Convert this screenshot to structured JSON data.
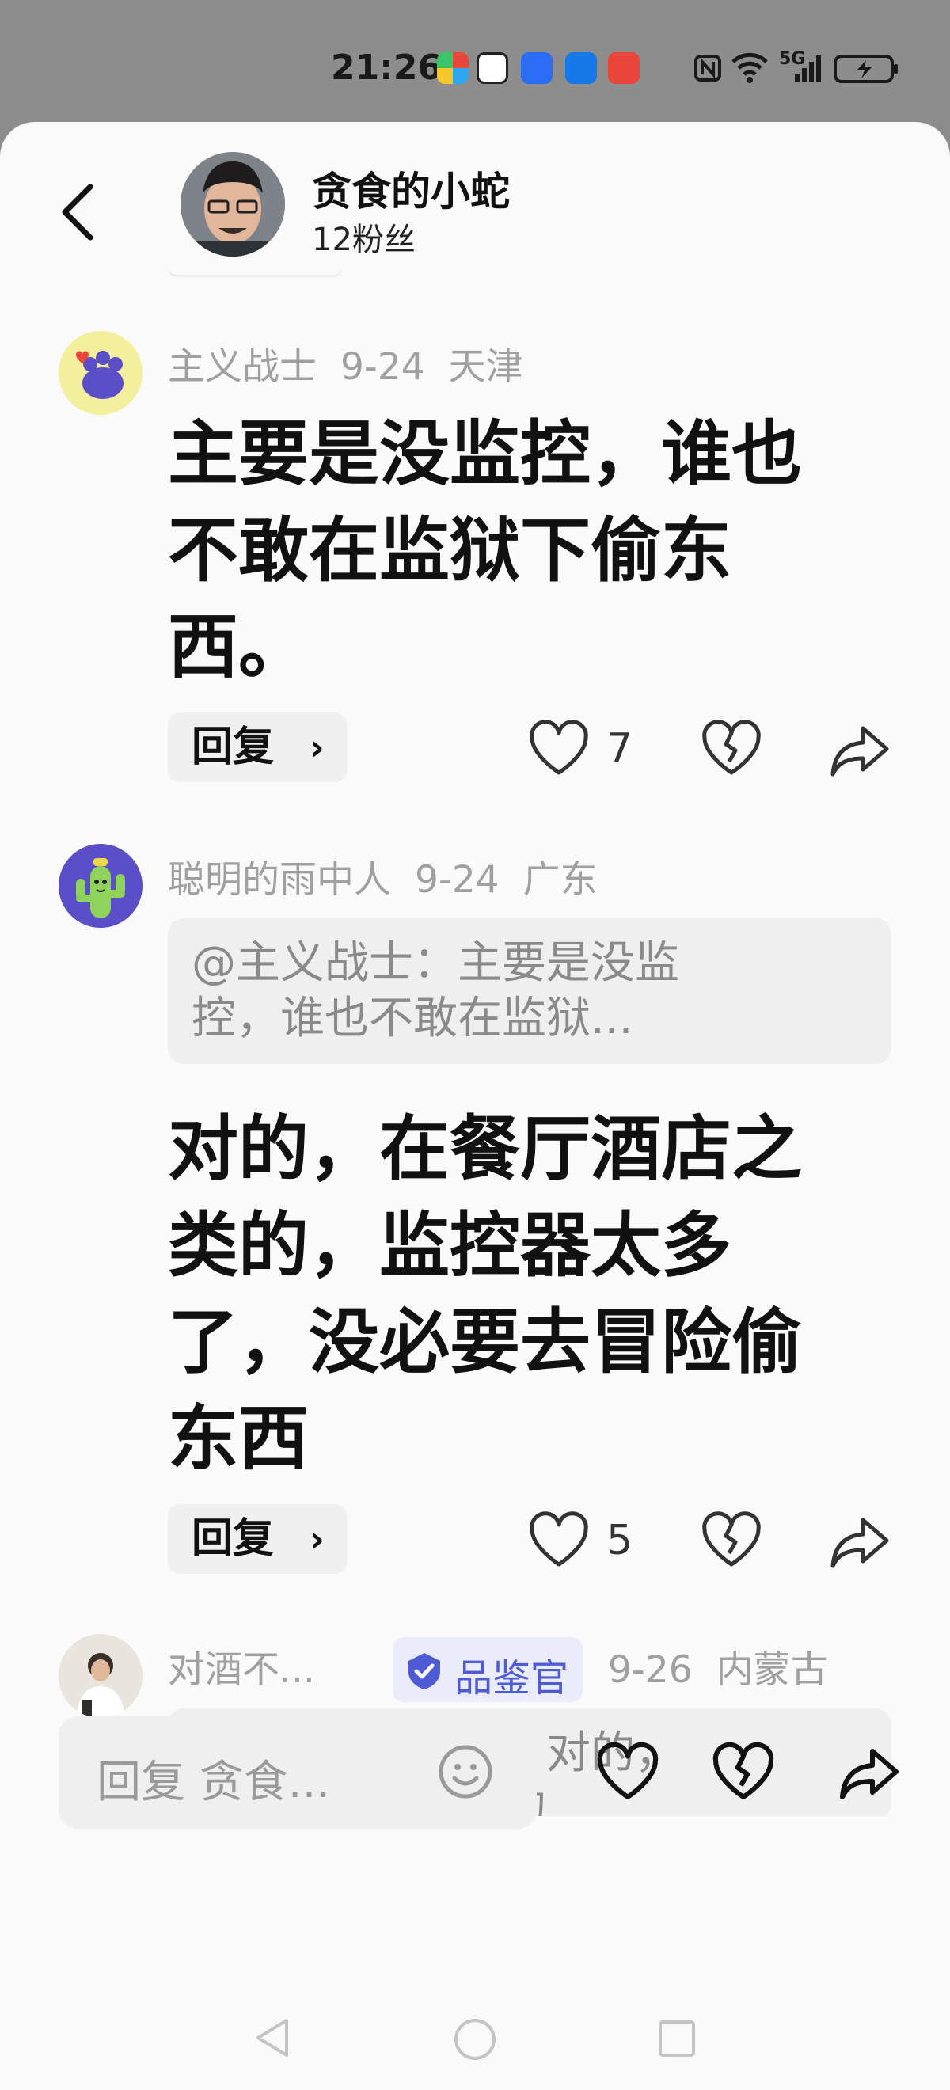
{
  "status_bar": {
    "time": "21:26",
    "network": "5G"
  },
  "header": {
    "author_name": "贪食的小蛇",
    "fans": "12粉丝"
  },
  "comments": [
    {
      "user": "主义战士",
      "date": "9-24",
      "location": "天津",
      "text": "主要是没监控，谁也不敢在监狱下偷东西。",
      "lines": [
        "主要是没监控，谁也",
        "不敢在监狱下偷东",
        "西。"
      ],
      "reply_label": "回复",
      "like_count": "7"
    },
    {
      "user": "聪明的雨中人",
      "date": "9-24",
      "location": "广东",
      "quote_lines": [
        "@主义战士：主要是没监",
        "控，谁也不敢在监狱..."
      ],
      "lines": [
        "对的，在餐厅酒店之",
        "类的，监控器太多",
        "了，没必要去冒险偷",
        "东西"
      ],
      "reply_label": "回复",
      "like_count": "5"
    },
    {
      "user": "对酒不...",
      "badge": "品鉴官",
      "date": "9-26",
      "location": "内蒙古",
      "quote_lines": [
        "@聪明的雨中人：对的，",
        "在餐厅酒店之类的"
      ]
    }
  ],
  "composer": {
    "placeholder": "回复 贪食..."
  },
  "colors": {
    "badge_blue": "#4f5bd5",
    "sheet_bg": "#fafafa",
    "status_bg": "#8d8d8d"
  }
}
